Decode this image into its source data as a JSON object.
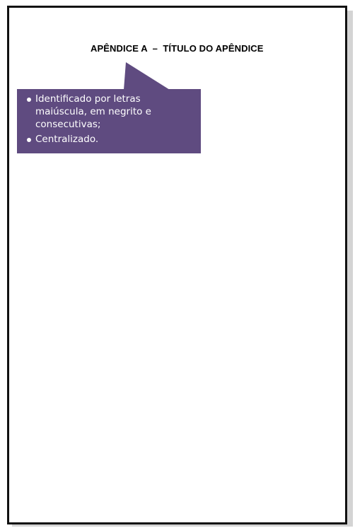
{
  "document": {
    "title": "APÊNDICE A  –  TÍTULO DO APÊNDICE"
  },
  "callout": {
    "items": [
      {
        "text": "Identificado por letras maiúscula, em negrito e consecutivas;"
      },
      {
        "text": "Centralizado."
      }
    ],
    "color": "#5f4b80"
  }
}
